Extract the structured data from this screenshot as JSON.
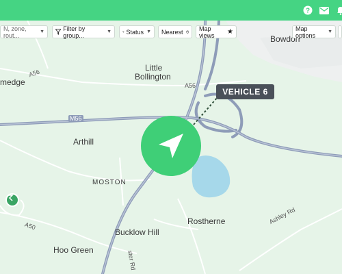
{
  "header": {
    "help_icon": "help-icon",
    "mail_icon": "mail-icon",
    "bell_icon": "bell-icon"
  },
  "toolbar": {
    "search_placeholder": "N, zone, rout...",
    "filter_label": "Filter by group...",
    "status_label": "Status",
    "nearest_label": "Nearest",
    "map_views_label": "Map views",
    "map_options_label": "Map options"
  },
  "map": {
    "vehicle_label": "VEHICLE 6",
    "places": {
      "bowdon": "Bowdon",
      "little": "Little",
      "bollington": "Bollington",
      "arthill": "Arthill",
      "moston": "MOSTON",
      "rostherne": "Rostherne",
      "bucklow_hill": "Bucklow Hill",
      "hoo_green": "Hoo Green",
      "mere_edge": "medge"
    },
    "roads": {
      "a56_left": "A56",
      "a56_right": "A56",
      "m56": "M56",
      "a50": "A50",
      "ashley_rd": "Ashley Rd",
      "chester_rd": "ster Rd"
    },
    "colors": {
      "land": "#e6f4e8",
      "motorway": "#8e9cb8",
      "water": "#a6d8ea",
      "accent": "#45d483",
      "vehicle_tag": "#4a5059"
    }
  }
}
